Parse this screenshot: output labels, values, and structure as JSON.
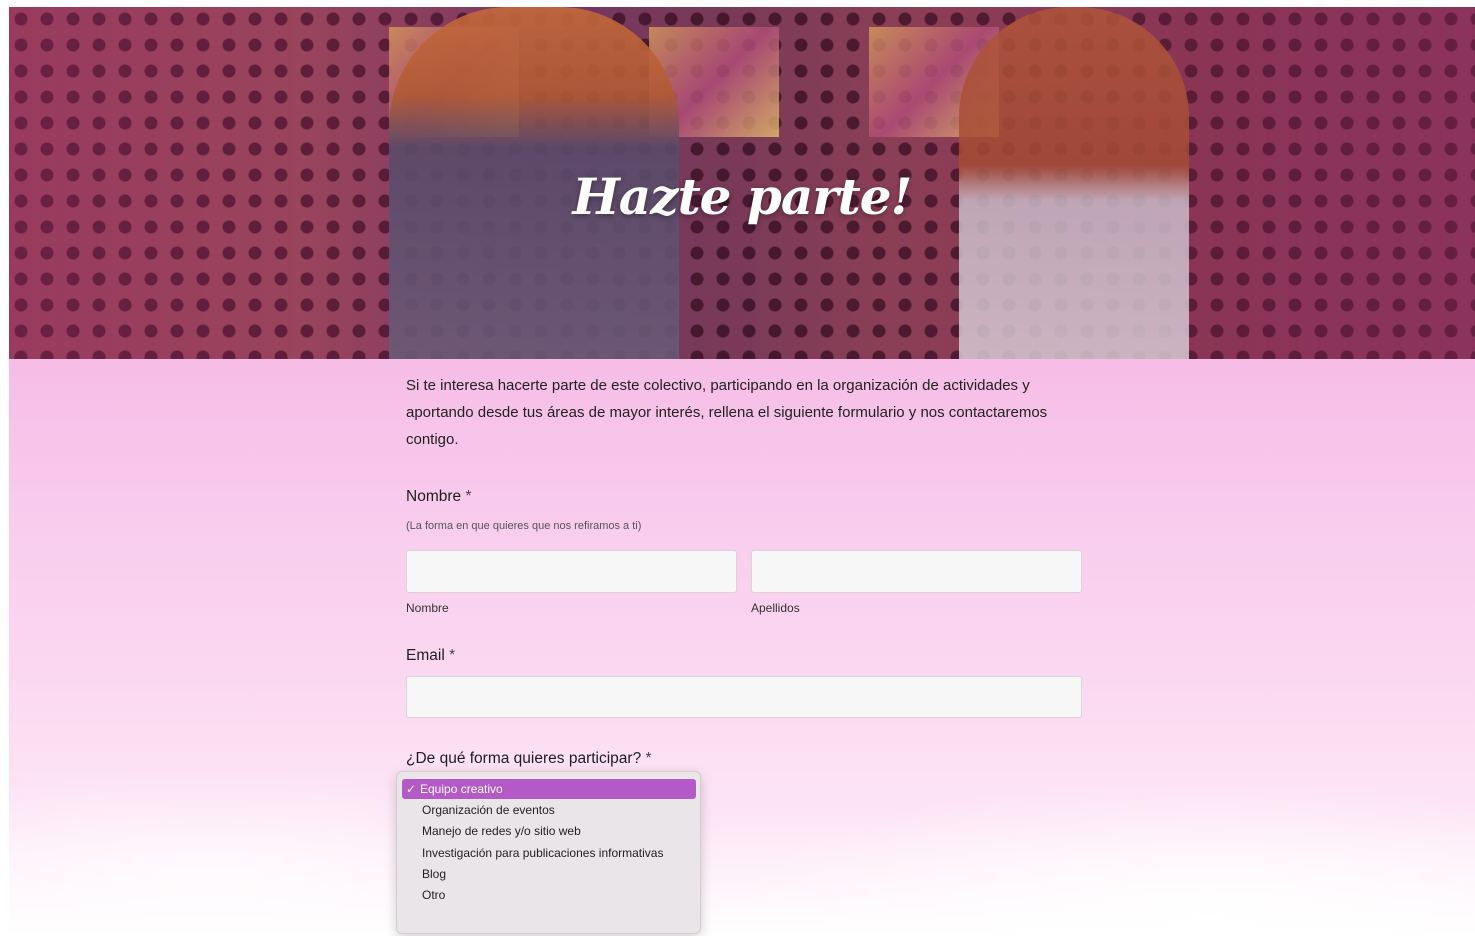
{
  "hero": {
    "title": "Hazte parte!"
  },
  "intro": "Si te interesa hacerte parte de este colectivo, participando en la organización de actividades y aportando desde tus áreas de mayor interés, rellena el siguiente formulario y nos contactaremos contigo.",
  "form": {
    "nombre_label": "Nombre",
    "nombre_hint": "(La forma en que quieres que nos refiramos a ti)",
    "first_name_sublabel": "Nombre",
    "last_name_sublabel": "Apellidos",
    "email_label": "Email",
    "participate_label": "¿De qué forma quieres participar?",
    "required_mark": "*",
    "options": [
      "Equipo creativo",
      "Organización de eventos",
      "Manejo de redes y/o sitio web",
      "Investigación para publicaciones informativas",
      "Blog",
      "Otro"
    ],
    "selected_option": "Equipo creativo",
    "check_icon": "✓"
  },
  "colors": {
    "accent": "#b35ac8",
    "background_pink": "#f6bde6"
  }
}
